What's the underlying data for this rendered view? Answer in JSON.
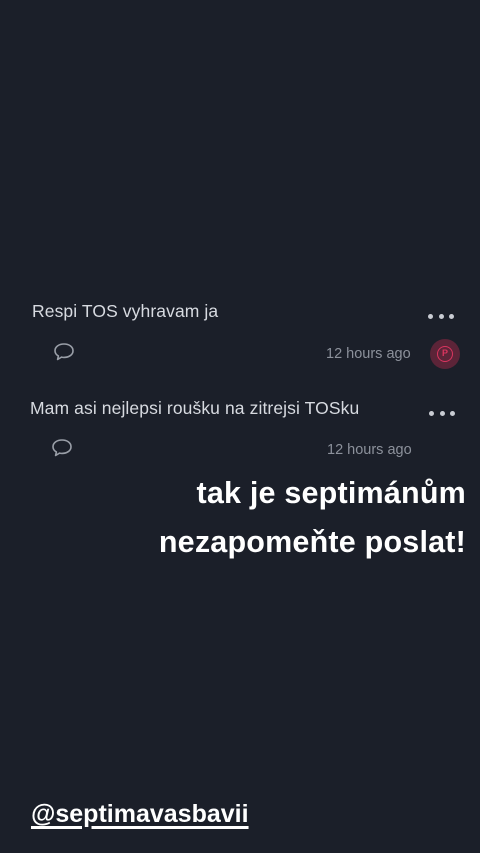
{
  "posts": [
    {
      "text": "Respi TOS vyhravam ja",
      "time": "12 hours ago",
      "has_badge": true
    },
    {
      "text": "Mam asi nejlepsi roušku na zitrejsi TOSku",
      "time": "12 hours ago",
      "has_badge": false
    }
  ],
  "overlay": {
    "line1": "tak je septimánům",
    "line2": "nezapomeňte poslat!"
  },
  "mention": "@septimavasbavii",
  "icons": {
    "more": "more-dots-icon",
    "comment": "comment-bubble-icon",
    "badge": "reaction-badge-icon"
  },
  "colors": {
    "background": "#1b1f29",
    "text": "#d7dae0",
    "muted": "#8c919b",
    "badge": "#d9355f"
  }
}
